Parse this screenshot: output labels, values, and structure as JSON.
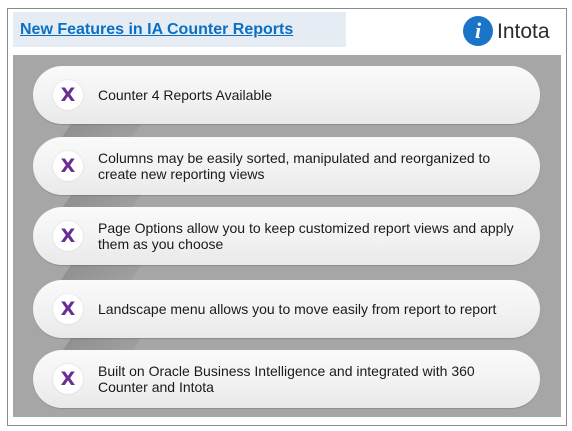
{
  "slide": {
    "title": "New Features in IA Counter Reports",
    "logo_letter": "i",
    "logo_text": "Intota",
    "bullet_glyph": "X",
    "bullet_color": "#6a2d91",
    "items": [
      {
        "text": "Counter 4 Reports Available"
      },
      {
        "text": "Columns may be easily sorted, manipulated and reorganized to create new reporting views"
      },
      {
        "text": "Page Options allow you to keep customized report views and apply them as you choose"
      },
      {
        "text": "Landscape menu allows you to move easily from report to report"
      },
      {
        "text": "Built on Oracle Business Intelligence and integrated with 360 Counter and Intota"
      }
    ]
  }
}
